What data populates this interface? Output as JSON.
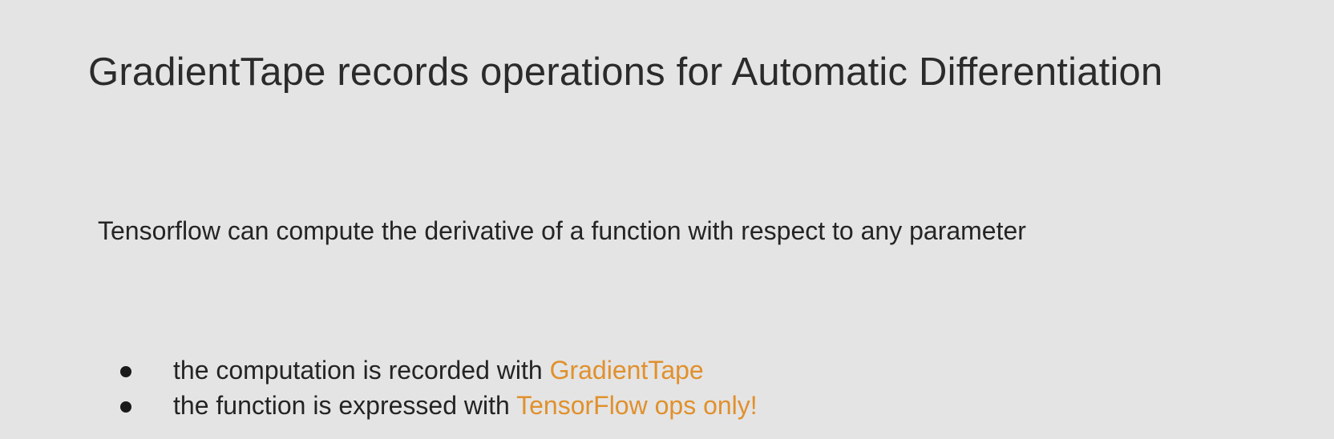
{
  "slide": {
    "title": "GradientTape records operations for Automatic Differentiation",
    "intro": "Tensorflow can compute the derivative of a function with respect to any parameter",
    "bullets": [
      {
        "text": "the computation is recorded with ",
        "highlight": "GradientTape"
      },
      {
        "text": "the function is expressed with ",
        "highlight": "TensorFlow ops only!"
      }
    ],
    "colors": {
      "background": "#e4e4e4",
      "text": "#242424",
      "highlight": "#e0902c"
    }
  }
}
